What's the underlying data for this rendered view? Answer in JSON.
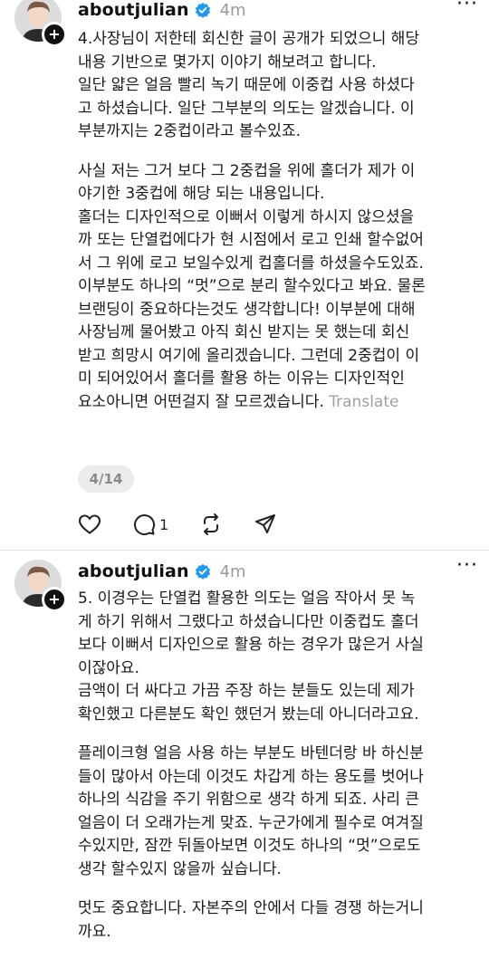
{
  "post1": {
    "username": "aboutjulian",
    "time": "4m",
    "more": "···",
    "lines": [
      "4.사장님이 저한테 회신한 글이 공개가 되었으니 해당",
      "내용 기반으로 몇가지 이야기 해보려고 합니다.",
      "일단 얇은 얼음 빨리 녹기 때문에 이중컵 사용 하셨다",
      "고 하셨습니다. 일단 그부분의 의도는 알겠습니다. 이",
      "부분까지는 2중컵이라고 볼수있죠."
    ],
    "lines2": [
      "사실 저는 그거 보다 그 2중컵을 위에 홀더가 제가 이",
      "야기한 3중컵에 해당 되는 내용입니다.",
      " 홀더는 디자인적으로 이뻐서 이렇게 하시지 않으셨을",
      "까 또는 단열컵에다가 현 시점에서 로고 인쇄 할수없어",
      "서 그 위에 로고 보일수있게 컵홀더를 하셨을수도있죠.",
      "이부분도 하나의 “멋”으로 분리 할수있다고 봐요. 물론",
      "브랜딩이 중요하다는것도 생각합니다! 이부분에 대해",
      "사장님께 물어봤고 아직 회신 받지는 못 했는데 회신",
      "받고 희망시 여기에 올리겠습니다. 그런데 2중컵이 이",
      "미 되어있어서 홀더를 활용 하는 이유는 디자인적인"
    ],
    "last_line": "요소아니면 어떤걸지 잘 모르겠습니다. ",
    "translate": "Translate",
    "pager": "4/14",
    "reply_count": "1"
  },
  "post2": {
    "username": "aboutjulian",
    "time": "4m",
    "more": "···",
    "lines": [
      "5. 이경우는 단열컵 활용한 의도는 얼음 작아서 못 녹",
      "게 하기 위해서 그랬다고 하셨습니다만 이중컵도 홀더",
      "보다 이뻐서 디자인으로 활용 하는 경우가 많은거 사실",
      "이잖아요.",
      "금액이 더 싸다고 가끔 주장 하는 분들도 있는데 제가",
      "확인했고 다른분도 확인 했던거 봤는데 아니더라고요."
    ],
    "lines2": [
      "플레이크형 얼음 사용 하는 부분도 바텐더랑 바 하신분",
      "들이 많아서 아는데 이것도 차갑게 하는 용도를 벗어나",
      "하나의 식감을 주기 위함으로 생각 하게 되죠. 사리 큰",
      "얼음이 더 오래가는게 맞죠. 누군가에게 필수로 여겨질",
      "수있지만, 잠깐 뒤돌아보면 이것도 하나의 “멋”으로도",
      "생각 할수있지 않을까 싶습니다."
    ],
    "lines3": [
      "멋도 중요합니다. 자본주의 안에서 다들 경쟁 하는거니",
      "까요."
    ]
  },
  "icons": {
    "verified": "verified-badge-icon",
    "like": "heart-icon",
    "reply": "comment-icon",
    "repost": "repost-icon",
    "share": "send-icon",
    "follow": "plus-icon"
  },
  "colors": {
    "verified": "#1d9bf0",
    "muted": "#9a9a9a"
  }
}
